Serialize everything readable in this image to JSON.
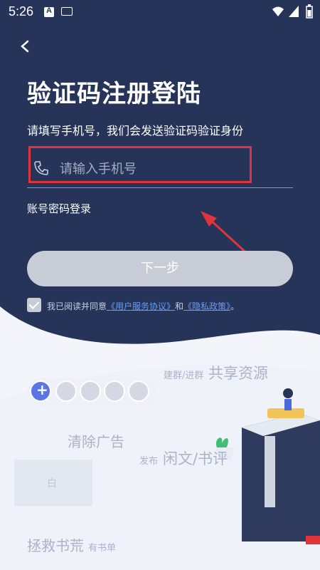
{
  "status_bar": {
    "time": "5:26"
  },
  "page": {
    "title": "验证码注册登陆",
    "subtitle": "请填写手机号，我们会发送验证码验证身份",
    "phone_placeholder": "请输入手机号",
    "alt_login": "账号密码登录",
    "next_button": "下一步",
    "agreement": {
      "prefix": "我已阅读并同意",
      "user_agreement": "《用户服务协议》",
      "and": "和",
      "privacy_policy": "《隐私政策》",
      "suffix": "。"
    }
  },
  "illustration": {
    "group_small": "建群/进群",
    "group_big": "共享资源",
    "remove_ads": "清除广告",
    "publish_small": "发布",
    "publish_big": "闲文/书评",
    "rescue_big": "拯救书荒",
    "rescue_small": "有书单",
    "card_label": "白"
  },
  "colors": {
    "header_bg": "#26345a",
    "highlight": "#e0343c",
    "link": "#6a9bf5",
    "button_bg": "#c8ccd6"
  }
}
